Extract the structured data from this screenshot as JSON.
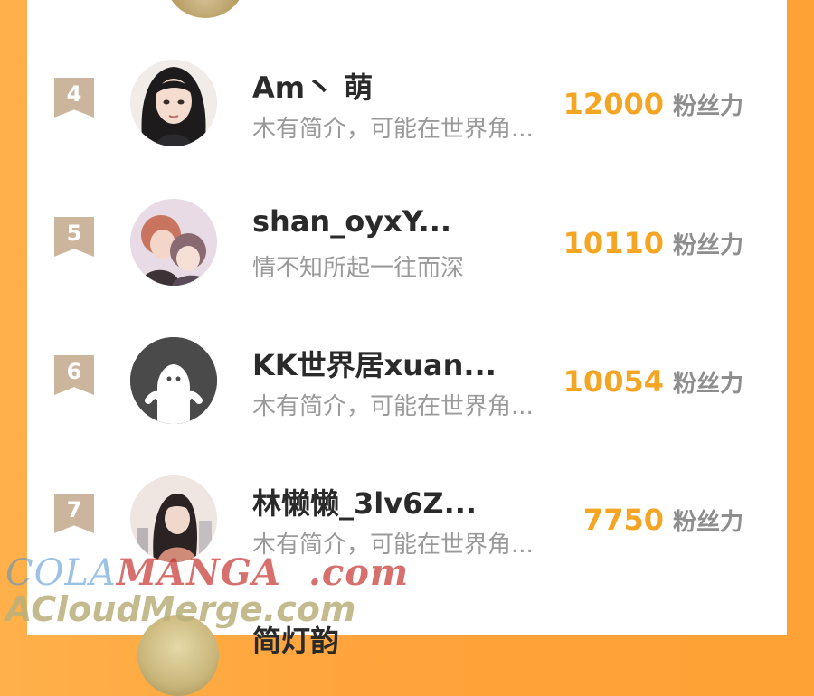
{
  "ranking": {
    "entries": [
      {
        "rank": "4",
        "name": "Am丶 萌",
        "bio": "木有简介，可能在世界角...",
        "fans": "12000",
        "fans_unit": "粉丝力",
        "avatar": "avatar-girl-dark-hair"
      },
      {
        "rank": "5",
        "name": "shan_oyxY...",
        "bio": "情不知所起一往而深",
        "fans": "10110",
        "fans_unit": "粉丝力",
        "avatar": "avatar-two-boys"
      },
      {
        "rank": "6",
        "name": "KK世界居xuan...",
        "bio": "木有简介，可能在世界角...",
        "fans": "10054",
        "fans_unit": "粉丝力",
        "avatar": "default-ghost-avatar"
      },
      {
        "rank": "7",
        "name": "林懒懒_3lv6Z...",
        "bio": "木有简介，可能在世界角...",
        "fans": "7750",
        "fans_unit": "粉丝力",
        "avatar": "avatar-girl-cityscape"
      }
    ],
    "next_partial_name": "简灯韵"
  },
  "watermark": {
    "line1_cola": "COLA",
    "line1_manga": "MANGA",
    "line1_com": ".com",
    "line2": "ACloudMerge.com"
  },
  "colors": {
    "background_orange": "#FFA33A",
    "fans_count": "#F5A524",
    "rank_badge": "#CBB59C"
  }
}
